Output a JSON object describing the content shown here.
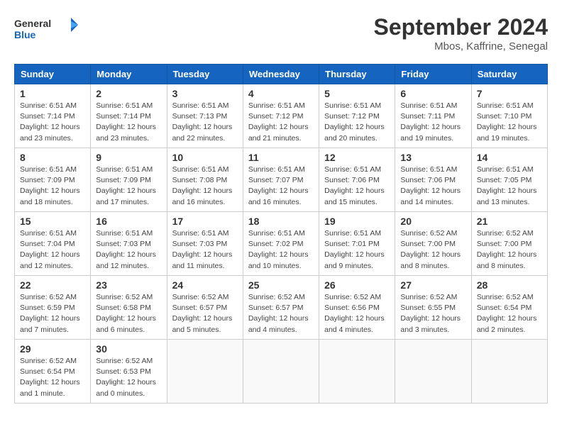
{
  "logo": {
    "line1": "General",
    "line2": "Blue"
  },
  "title": "September 2024",
  "location": "Mbos, Kaffrine, Senegal",
  "headers": [
    "Sunday",
    "Monday",
    "Tuesday",
    "Wednesday",
    "Thursday",
    "Friday",
    "Saturday"
  ],
  "weeks": [
    [
      {
        "day": "1",
        "detail": "Sunrise: 6:51 AM\nSunset: 7:14 PM\nDaylight: 12 hours\nand 23 minutes."
      },
      {
        "day": "2",
        "detail": "Sunrise: 6:51 AM\nSunset: 7:14 PM\nDaylight: 12 hours\nand 23 minutes."
      },
      {
        "day": "3",
        "detail": "Sunrise: 6:51 AM\nSunset: 7:13 PM\nDaylight: 12 hours\nand 22 minutes."
      },
      {
        "day": "4",
        "detail": "Sunrise: 6:51 AM\nSunset: 7:12 PM\nDaylight: 12 hours\nand 21 minutes."
      },
      {
        "day": "5",
        "detail": "Sunrise: 6:51 AM\nSunset: 7:12 PM\nDaylight: 12 hours\nand 20 minutes."
      },
      {
        "day": "6",
        "detail": "Sunrise: 6:51 AM\nSunset: 7:11 PM\nDaylight: 12 hours\nand 19 minutes."
      },
      {
        "day": "7",
        "detail": "Sunrise: 6:51 AM\nSunset: 7:10 PM\nDaylight: 12 hours\nand 19 minutes."
      }
    ],
    [
      {
        "day": "8",
        "detail": "Sunrise: 6:51 AM\nSunset: 7:09 PM\nDaylight: 12 hours\nand 18 minutes."
      },
      {
        "day": "9",
        "detail": "Sunrise: 6:51 AM\nSunset: 7:09 PM\nDaylight: 12 hours\nand 17 minutes."
      },
      {
        "day": "10",
        "detail": "Sunrise: 6:51 AM\nSunset: 7:08 PM\nDaylight: 12 hours\nand 16 minutes."
      },
      {
        "day": "11",
        "detail": "Sunrise: 6:51 AM\nSunset: 7:07 PM\nDaylight: 12 hours\nand 16 minutes."
      },
      {
        "day": "12",
        "detail": "Sunrise: 6:51 AM\nSunset: 7:06 PM\nDaylight: 12 hours\nand 15 minutes."
      },
      {
        "day": "13",
        "detail": "Sunrise: 6:51 AM\nSunset: 7:06 PM\nDaylight: 12 hours\nand 14 minutes."
      },
      {
        "day": "14",
        "detail": "Sunrise: 6:51 AM\nSunset: 7:05 PM\nDaylight: 12 hours\nand 13 minutes."
      }
    ],
    [
      {
        "day": "15",
        "detail": "Sunrise: 6:51 AM\nSunset: 7:04 PM\nDaylight: 12 hours\nand 12 minutes."
      },
      {
        "day": "16",
        "detail": "Sunrise: 6:51 AM\nSunset: 7:03 PM\nDaylight: 12 hours\nand 12 minutes."
      },
      {
        "day": "17",
        "detail": "Sunrise: 6:51 AM\nSunset: 7:03 PM\nDaylight: 12 hours\nand 11 minutes."
      },
      {
        "day": "18",
        "detail": "Sunrise: 6:51 AM\nSunset: 7:02 PM\nDaylight: 12 hours\nand 10 minutes."
      },
      {
        "day": "19",
        "detail": "Sunrise: 6:51 AM\nSunset: 7:01 PM\nDaylight: 12 hours\nand 9 minutes."
      },
      {
        "day": "20",
        "detail": "Sunrise: 6:52 AM\nSunset: 7:00 PM\nDaylight: 12 hours\nand 8 minutes."
      },
      {
        "day": "21",
        "detail": "Sunrise: 6:52 AM\nSunset: 7:00 PM\nDaylight: 12 hours\nand 8 minutes."
      }
    ],
    [
      {
        "day": "22",
        "detail": "Sunrise: 6:52 AM\nSunset: 6:59 PM\nDaylight: 12 hours\nand 7 minutes."
      },
      {
        "day": "23",
        "detail": "Sunrise: 6:52 AM\nSunset: 6:58 PM\nDaylight: 12 hours\nand 6 minutes."
      },
      {
        "day": "24",
        "detail": "Sunrise: 6:52 AM\nSunset: 6:57 PM\nDaylight: 12 hours\nand 5 minutes."
      },
      {
        "day": "25",
        "detail": "Sunrise: 6:52 AM\nSunset: 6:57 PM\nDaylight: 12 hours\nand 4 minutes."
      },
      {
        "day": "26",
        "detail": "Sunrise: 6:52 AM\nSunset: 6:56 PM\nDaylight: 12 hours\nand 4 minutes."
      },
      {
        "day": "27",
        "detail": "Sunrise: 6:52 AM\nSunset: 6:55 PM\nDaylight: 12 hours\nand 3 minutes."
      },
      {
        "day": "28",
        "detail": "Sunrise: 6:52 AM\nSunset: 6:54 PM\nDaylight: 12 hours\nand 2 minutes."
      }
    ],
    [
      {
        "day": "29",
        "detail": "Sunrise: 6:52 AM\nSunset: 6:54 PM\nDaylight: 12 hours\nand 1 minute."
      },
      {
        "day": "30",
        "detail": "Sunrise: 6:52 AM\nSunset: 6:53 PM\nDaylight: 12 hours\nand 0 minutes."
      },
      {
        "day": "",
        "detail": ""
      },
      {
        "day": "",
        "detail": ""
      },
      {
        "day": "",
        "detail": ""
      },
      {
        "day": "",
        "detail": ""
      },
      {
        "day": "",
        "detail": ""
      }
    ]
  ]
}
